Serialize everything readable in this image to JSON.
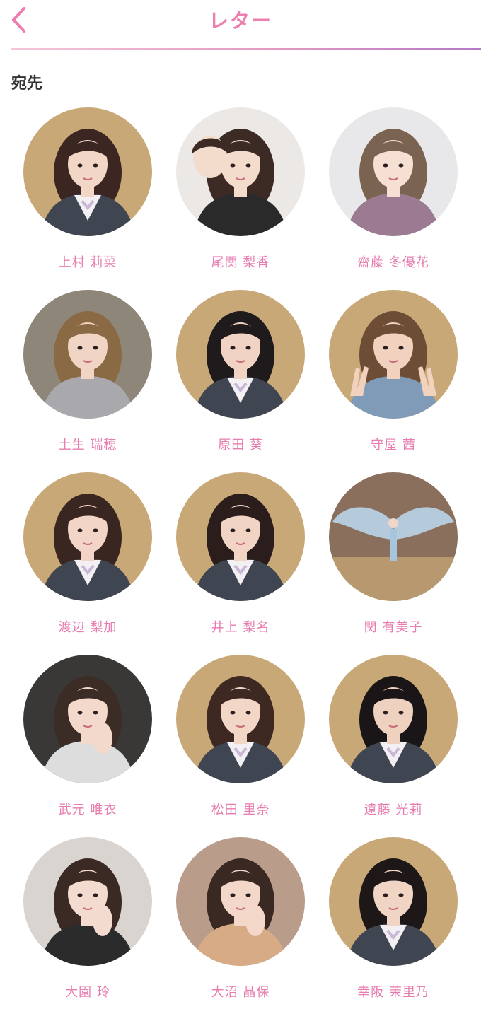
{
  "header": {
    "title": "レター",
    "back_icon": "chevron-left-icon",
    "accent_color": "#ea7fb0"
  },
  "section": {
    "label": "宛先"
  },
  "members": [
    {
      "name": "上村 莉菜",
      "photo": "uniform",
      "bg": "#c9a877",
      "hair": "#3b2622",
      "skin": "#f2d6c6",
      "top": "#3f4651"
    },
    {
      "name": "尾関 梨香",
      "photo": "selfie-pair",
      "bg": "#ece8e6",
      "hair": "#3c2a24",
      "skin": "#f4dccd",
      "top": "#2a2a2a"
    },
    {
      "name": "齋藤 冬優花",
      "photo": "casual",
      "bg": "#e8e8ea",
      "hair": "#7a6350",
      "skin": "#f6dfd3",
      "top": "#9b7a92"
    },
    {
      "name": "土生 瑞穂",
      "photo": "casual-rock",
      "bg": "#8e8678",
      "hair": "#8a6a45",
      "skin": "#f0d5c4",
      "top": "#a9a9ad"
    },
    {
      "name": "原田 葵",
      "photo": "uniform",
      "bg": "#c9a877",
      "hair": "#1f1a1c",
      "skin": "#f0d3c2",
      "top": "#3f4651"
    },
    {
      "name": "守屋 茜",
      "photo": "peace",
      "bg": "#c9a877",
      "hair": "#6d4d35",
      "skin": "#f1d2bf",
      "top": "#7f9bb8"
    },
    {
      "name": "渡辺 梨加",
      "photo": "uniform",
      "bg": "#c9a877",
      "hair": "#3a2620",
      "skin": "#f2d5c6",
      "top": "#3f4651"
    },
    {
      "name": "井上 梨名",
      "photo": "uniform",
      "bg": "#c9a877",
      "hair": "#2a1d1b",
      "skin": "#f1d4c3",
      "top": "#3f4651"
    },
    {
      "name": "関 有美子",
      "photo": "wings",
      "bg": "#8a6f5c",
      "hair": "#3a2a22",
      "skin": "#f0d6c8",
      "top": "#a7c5dd"
    },
    {
      "name": "武元 唯衣",
      "photo": "selfie",
      "bg": "#3a3836",
      "hair": "#3b2c26",
      "skin": "#f3d9cc",
      "top": "#dddddd"
    },
    {
      "name": "松田 里奈",
      "photo": "uniform",
      "bg": "#c9a877",
      "hair": "#3d2822",
      "skin": "#f2d6c6",
      "top": "#3f4651"
    },
    {
      "name": "遠藤 光莉",
      "photo": "uniform",
      "bg": "#c9a877",
      "hair": "#1a1516",
      "skin": "#efd1c0",
      "top": "#3f4651"
    },
    {
      "name": "大園 玲",
      "photo": "selfie",
      "bg": "#d9d4d0",
      "hair": "#3b2a24",
      "skin": "#f4dbcf",
      "top": "#2b2b2b"
    },
    {
      "name": "大沼 晶保",
      "photo": "selfie-point",
      "bg": "#b99c8a",
      "hair": "#3a2822",
      "skin": "#f3d8c9",
      "top": "#d6ab86"
    },
    {
      "name": "幸阪 茉里乃",
      "photo": "uniform",
      "bg": "#c9a877",
      "hair": "#1d1718",
      "skin": "#f0d4c4",
      "top": "#3f4651"
    }
  ]
}
